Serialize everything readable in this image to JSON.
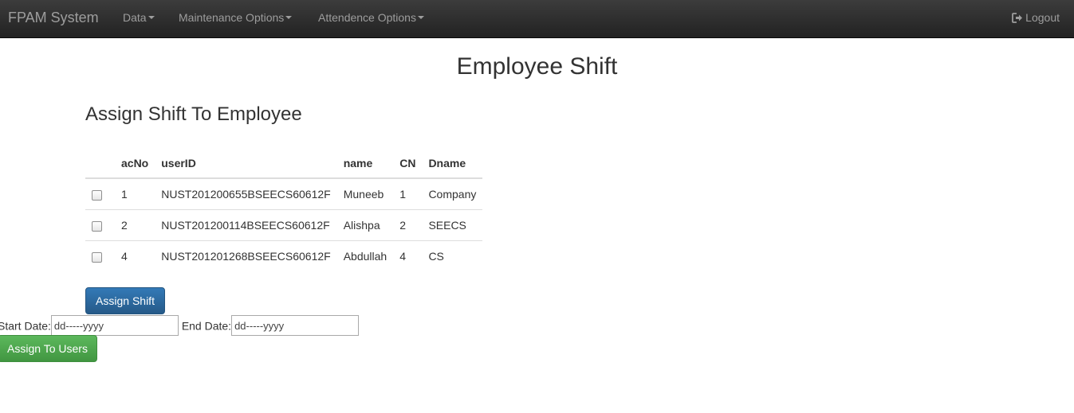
{
  "navbar": {
    "brand": "FPAM System",
    "menus": [
      {
        "label": "Data"
      },
      {
        "label": "Maintenance Options"
      },
      {
        "label": "Attendence Options"
      }
    ],
    "logout_label": "Logout",
    "logout_icon": "logout-icon"
  },
  "page": {
    "title": "Employee Shift",
    "section_title": "Assign Shift To Employee"
  },
  "table": {
    "headers": [
      "acNo",
      "userID",
      "name",
      "CN",
      "Dname"
    ],
    "rows": [
      {
        "checked": false,
        "acNo": "1",
        "userID": "NUST201200655BSEECS60612F",
        "name": "Muneeb",
        "CN": "1",
        "Dname": "Company"
      },
      {
        "checked": false,
        "acNo": "2",
        "userID": "NUST201200114BSEECS60612F",
        "name": "Alishpa",
        "CN": "2",
        "Dname": "SEECS"
      },
      {
        "checked": false,
        "acNo": "4",
        "userID": "NUST201201268BSEECS60612F",
        "name": "Abdullah",
        "CN": "4",
        "Dname": "CS"
      }
    ]
  },
  "actions": {
    "assign_shift_label": "Assign Shift",
    "start_date_label": "Start Date:",
    "start_date_value": "dd-----yyyy",
    "end_date_label": "End Date:",
    "end_date_value": "dd-----yyyy",
    "assign_users_label": "Assign To Users"
  },
  "colors": {
    "navbar_bg": "#222222",
    "primary": "#337ab7",
    "success": "#5cb85c"
  }
}
